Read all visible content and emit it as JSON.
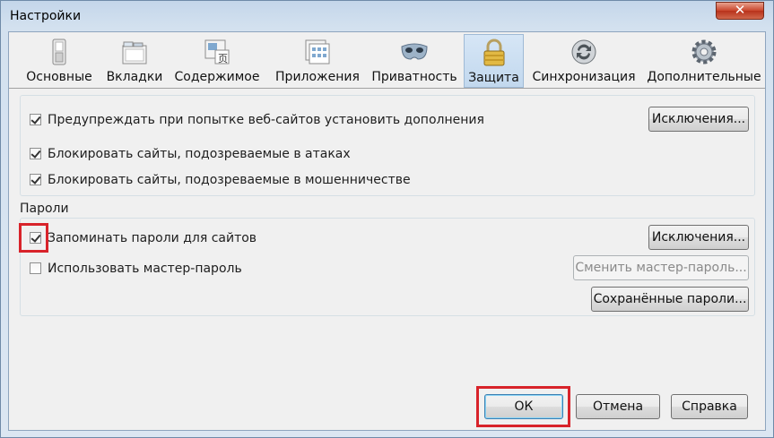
{
  "window": {
    "title": "Настройки",
    "close_label": "✕"
  },
  "tabs": [
    {
      "label": "Основные",
      "icon": "switch-icon"
    },
    {
      "label": "Вкладки",
      "icon": "tabs-icon"
    },
    {
      "label": "Содержимое",
      "icon": "content-icon"
    },
    {
      "label": "Приложения",
      "icon": "applications-icon"
    },
    {
      "label": "Приватность",
      "icon": "mask-icon"
    },
    {
      "label": "Защита",
      "icon": "lock-icon",
      "active": true
    },
    {
      "label": "Синхронизация",
      "icon": "sync-icon"
    },
    {
      "label": "Дополнительные",
      "icon": "gear-icon"
    }
  ],
  "security": {
    "warn_addons": {
      "label": "Предупреждать при попытке веб-сайтов установить дополнения",
      "checked": true
    },
    "exceptions1_label": "Исключения...",
    "block_attack": {
      "label": "Блокировать сайты, подозреваемые в атаках",
      "checked": true
    },
    "block_forgery": {
      "label": "Блокировать сайты, подозреваемые в мошенничестве",
      "checked": true
    }
  },
  "passwords": {
    "group_label": "Пароли",
    "remember": {
      "label": "Запоминать пароли для сайтов",
      "checked": true
    },
    "exceptions2_label": "Исключения...",
    "master": {
      "label": "Использовать мастер-пароль",
      "checked": false
    },
    "change_master_label": "Сменить мастер-пароль...",
    "saved_passwords_label": "Сохранённые пароли..."
  },
  "footer": {
    "ok_label": "ОК",
    "cancel_label": "Отмена",
    "help_label": "Справка"
  },
  "colors": {
    "highlight": "#d8232a",
    "active_tab": "#c2d8ee"
  }
}
